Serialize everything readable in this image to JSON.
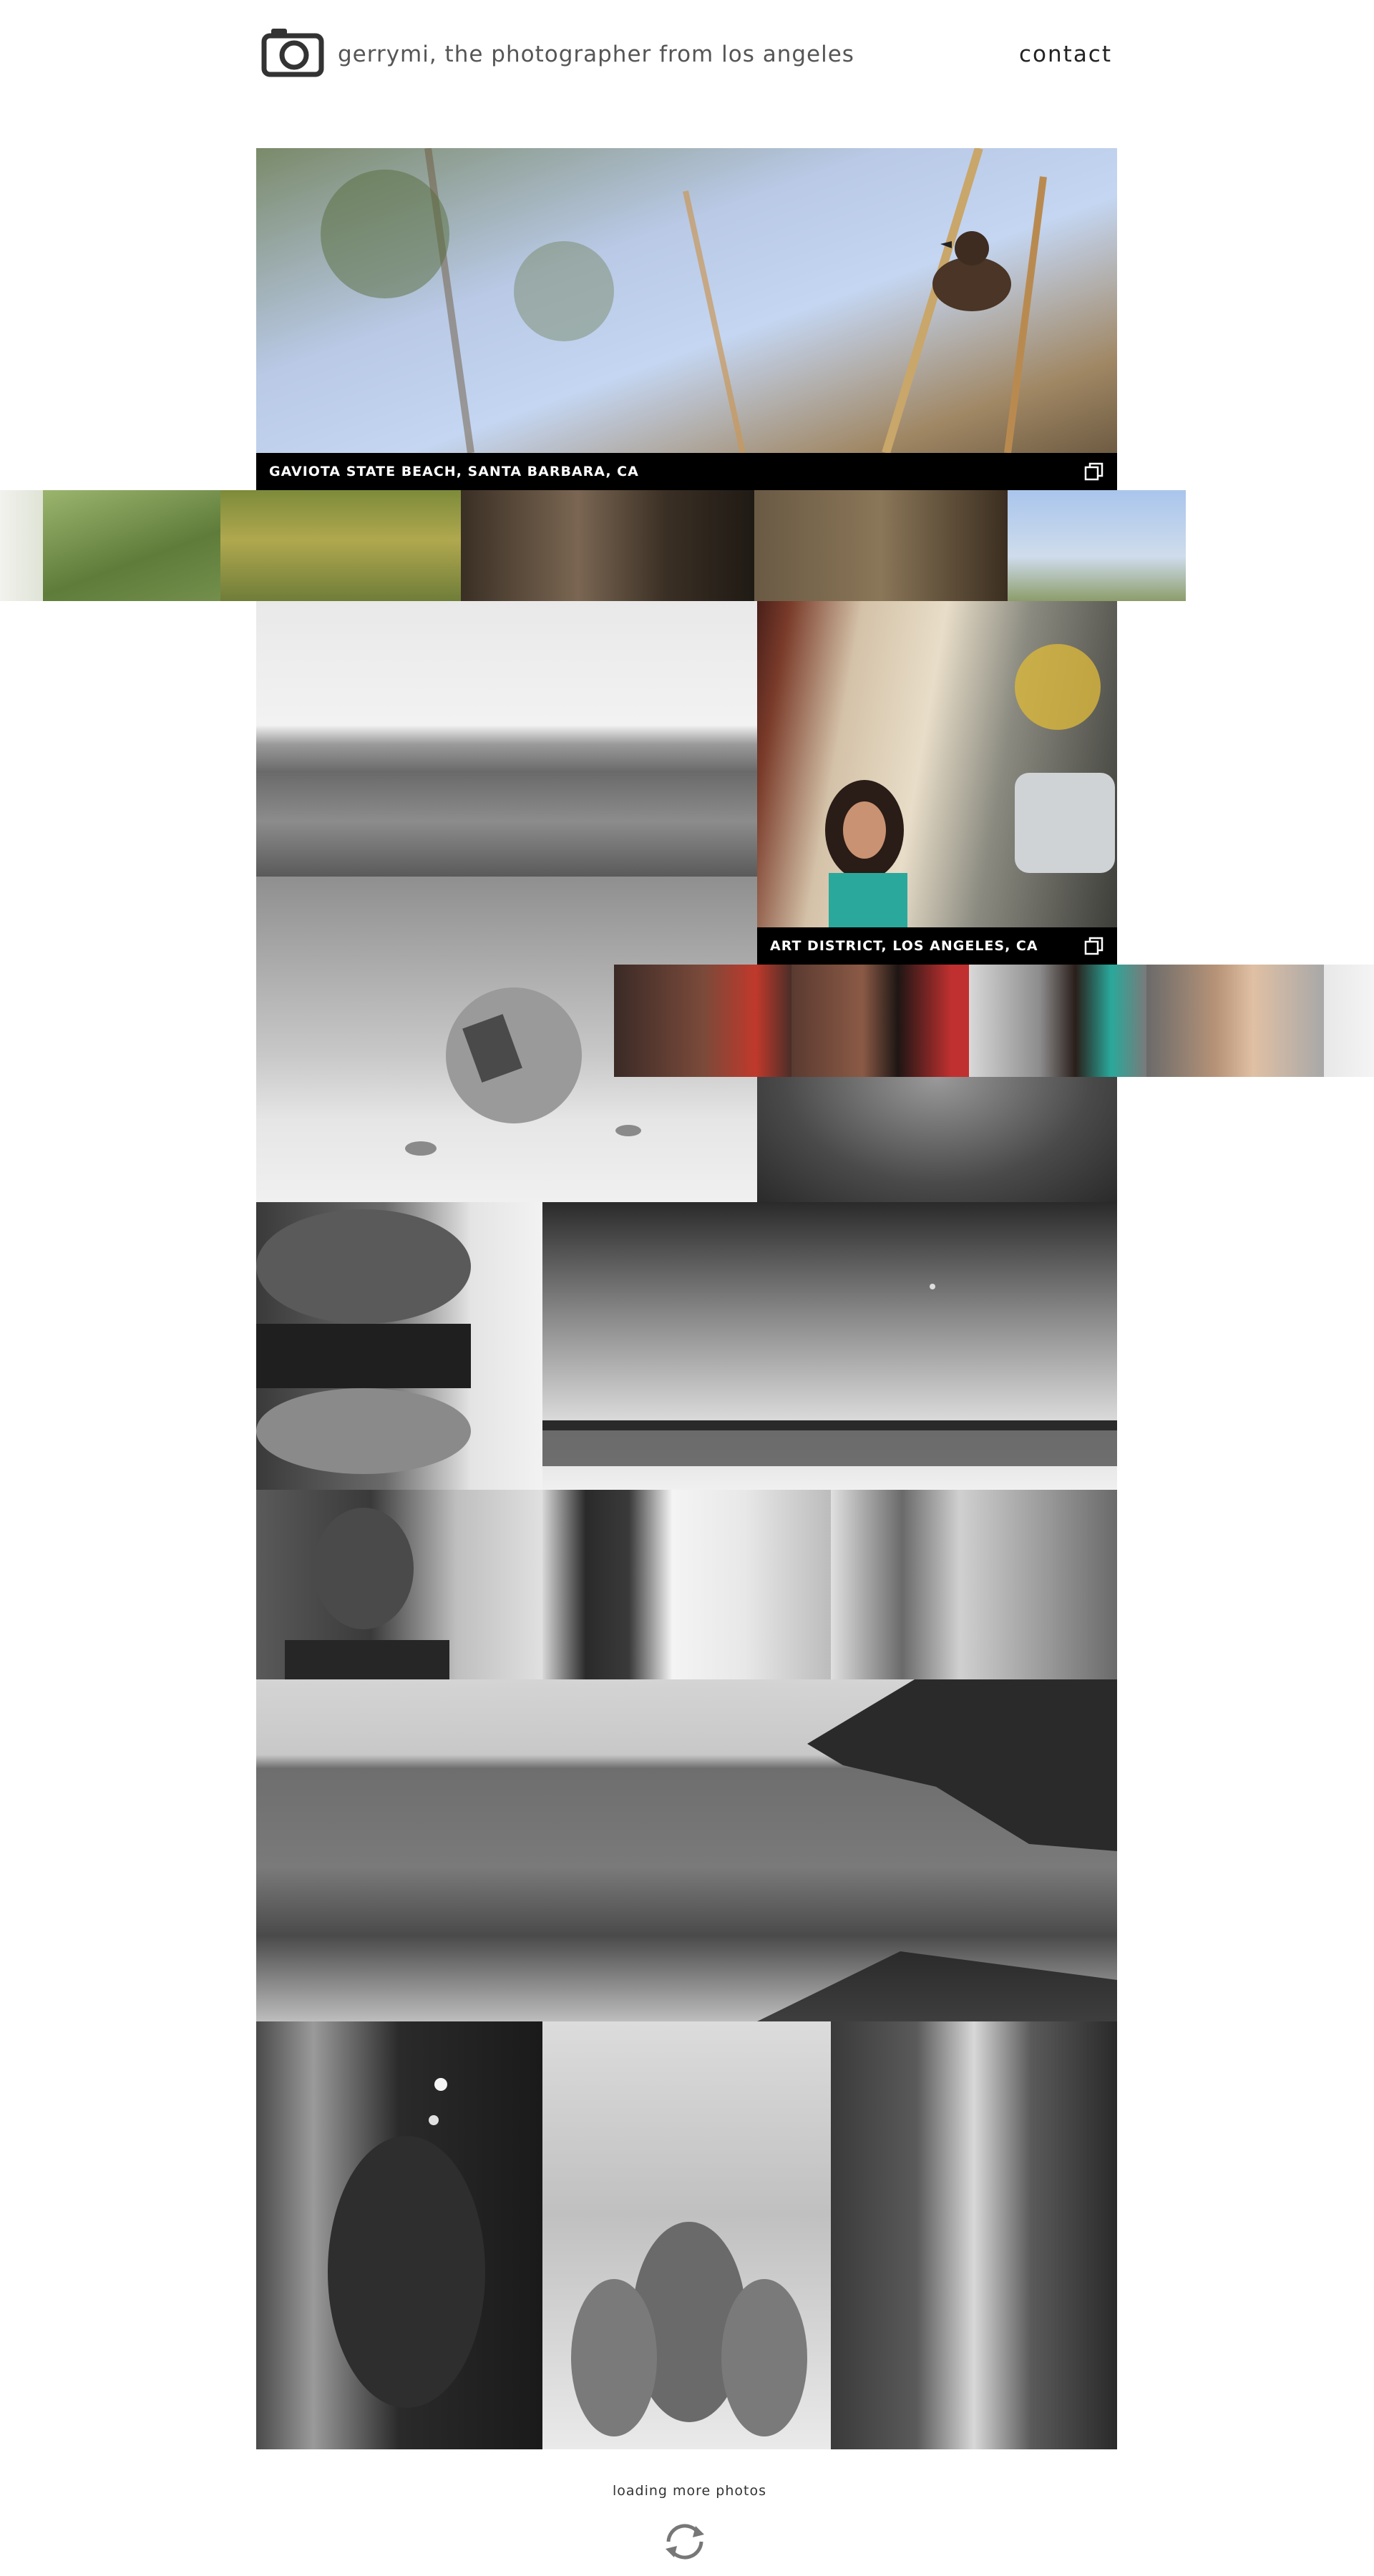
{
  "header": {
    "logo_icon": "camera-icon",
    "title": "gerrymi, the photographer from los angeles",
    "contact_label": "contact"
  },
  "featured": [
    {
      "caption": "GAVIOTA STATE BEACH, SANTA BARBARA, CA",
      "icon": "gallery-icon"
    },
    {
      "caption": "ART DISTRICT, LOS ANGELES, CA",
      "icon": "gallery-icon"
    }
  ],
  "footer": {
    "loading_text": "loading more photos",
    "spinner_icon": "refresh-icon"
  }
}
